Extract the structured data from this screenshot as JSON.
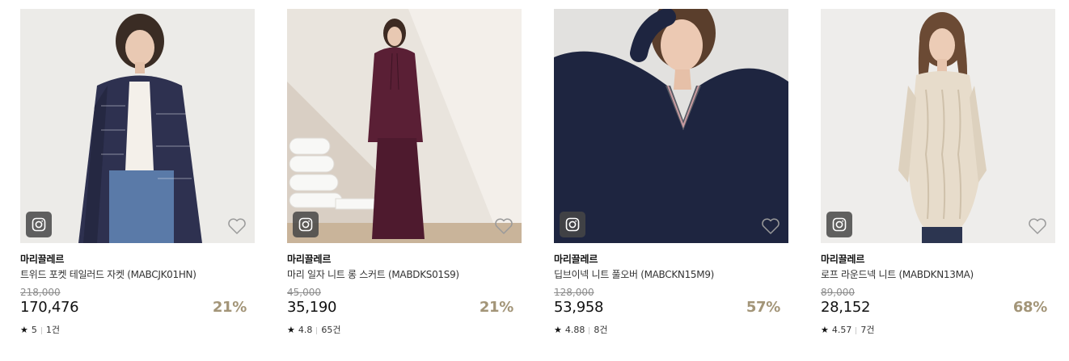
{
  "colors": {
    "discount": "#a39578",
    "insta_badge": "#464646"
  },
  "products": [
    {
      "brand": "마리끌레르",
      "name": "트위드 포켓 테일러드 자켓 (MABCJK01HN)",
      "original_price": "218,000",
      "price": "170,476",
      "discount": "21%",
      "rating": "5",
      "reviews": "1건",
      "icons": [
        "instagram-icon",
        "heart-icon",
        "star-icon"
      ]
    },
    {
      "brand": "마리끌레르",
      "name": "마리 일자 니트 롱 스커트 (MABDKS01S9)",
      "original_price": "45,000",
      "price": "35,190",
      "discount": "21%",
      "rating": "4.8",
      "reviews": "65건",
      "icons": [
        "instagram-icon",
        "heart-icon",
        "star-icon"
      ]
    },
    {
      "brand": "마리끌레르",
      "name": "딥브이넥 니트 풀오버 (MABCKN15M9)",
      "original_price": "128,000",
      "price": "53,958",
      "discount": "57%",
      "rating": "4.88",
      "reviews": "8건",
      "icons": [
        "instagram-icon",
        "heart-icon",
        "star-icon"
      ]
    },
    {
      "brand": "마리끌레르",
      "name": "로프 라운드넥 니트 (MABDKN13MA)",
      "original_price": "89,000",
      "price": "28,152",
      "discount": "68%",
      "rating": "4.57",
      "reviews": "7건",
      "icons": [
        "instagram-icon",
        "heart-icon",
        "star-icon"
      ]
    }
  ]
}
